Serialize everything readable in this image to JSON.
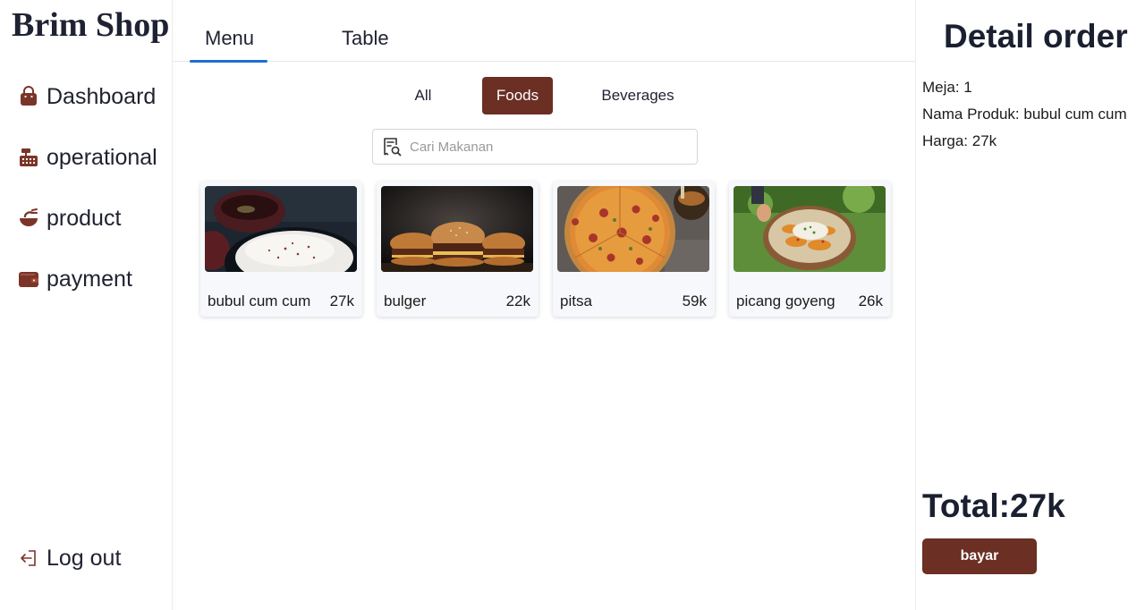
{
  "brand": "Brim Shop",
  "colors": {
    "accent": "#6b2f24",
    "tab_underline": "#1f6fd1",
    "heading": "#1a2030"
  },
  "sidebar": {
    "items": [
      {
        "label": "Dashboard",
        "icon": "shopping-bag-icon"
      },
      {
        "label": "operational",
        "icon": "cash-register-icon"
      },
      {
        "label": "product",
        "icon": "food-bowl-icon"
      },
      {
        "label": "payment",
        "icon": "wallet-icon"
      }
    ],
    "logout": {
      "label": "Log out",
      "icon": "logout-icon"
    }
  },
  "tabs": [
    {
      "label": "Menu",
      "active": true
    },
    {
      "label": "Table",
      "active": false
    }
  ],
  "categories": [
    {
      "label": "All",
      "active": false
    },
    {
      "label": "Foods",
      "active": true
    },
    {
      "label": "Beverages",
      "active": false
    }
  ],
  "search": {
    "placeholder": "Cari Makanan",
    "value": "",
    "icon": "receipt-search-icon"
  },
  "products": [
    {
      "name": "bubul cum cum",
      "price": "27k"
    },
    {
      "name": "bulger",
      "price": "22k"
    },
    {
      "name": "pitsa",
      "price": "59k"
    },
    {
      "name": "picang goyeng",
      "price": "26k"
    }
  ],
  "detail": {
    "title": "Detail order",
    "meja": "Meja: 1",
    "produk": "Nama Produk: bubul cum cum",
    "harga": "Harga: 27k",
    "total": "Total:27k",
    "pay_label": "bayar"
  }
}
